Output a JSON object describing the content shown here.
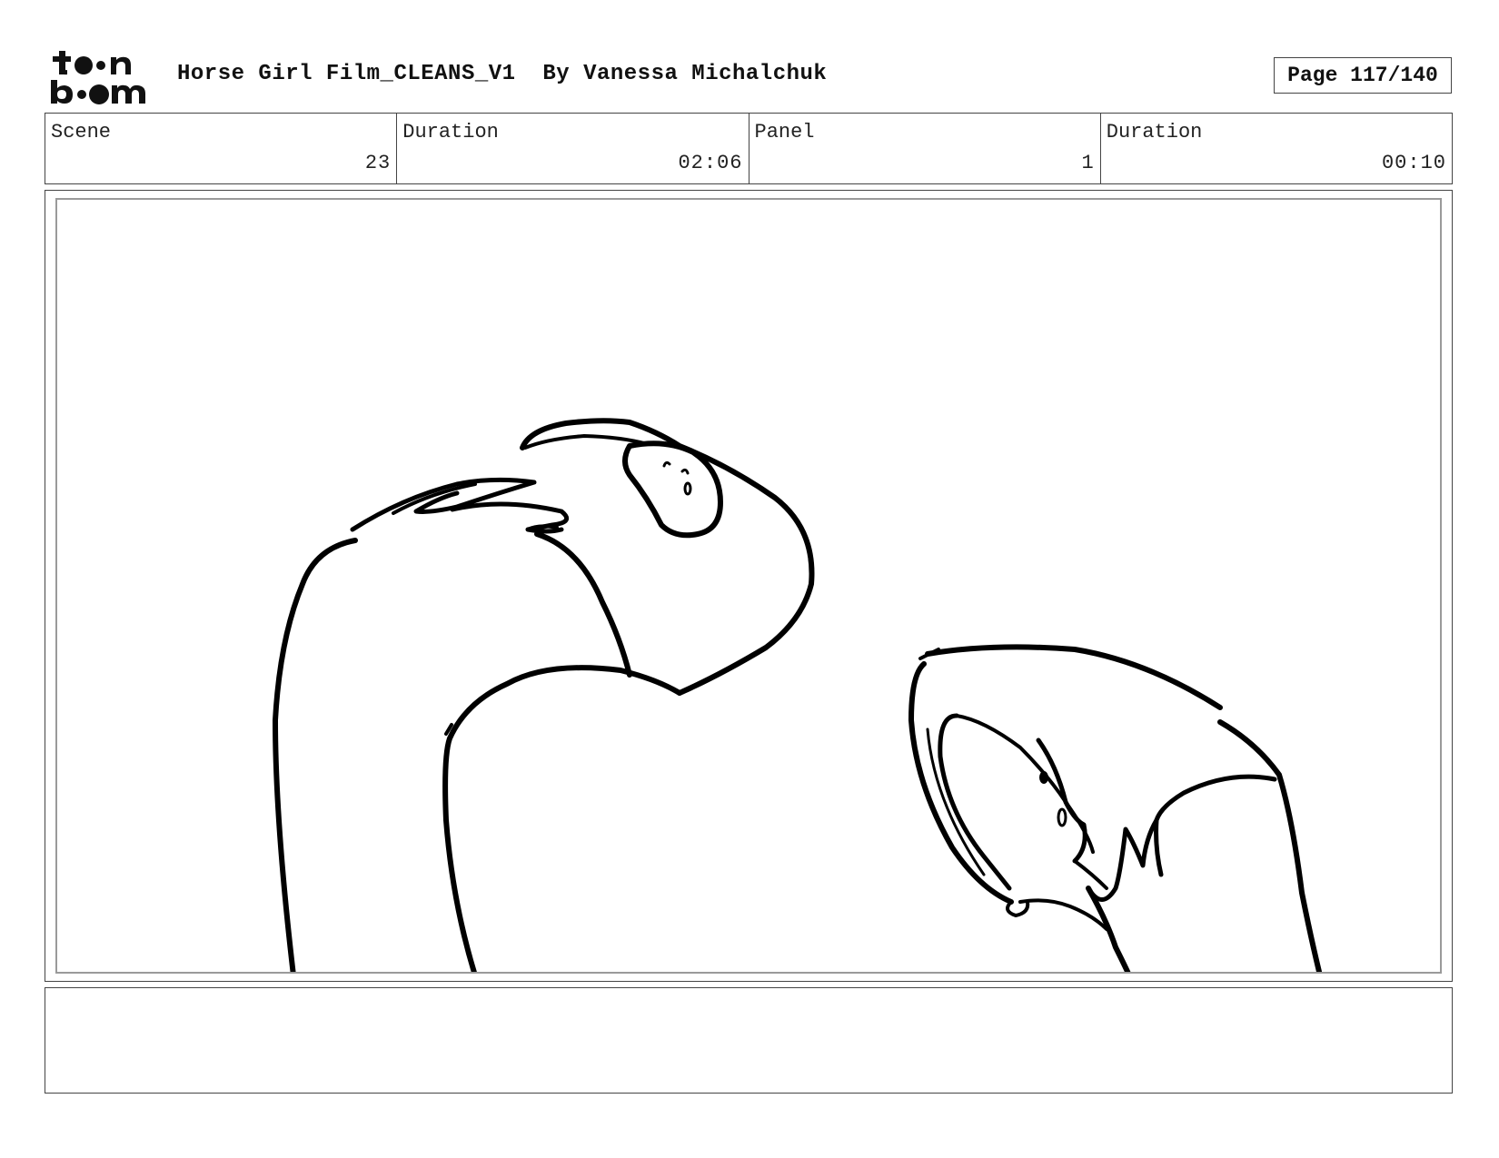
{
  "header": {
    "logo_text": "toon boom",
    "title": "Horse Girl Film_CLEANS_V1  By Vanessa Michalchuk",
    "page": "Page 117/140"
  },
  "info": {
    "scene_label": "Scene",
    "scene_value": "23",
    "scene_duration_label": "Duration",
    "scene_duration_value": "02:06",
    "panel_label": "Panel",
    "panel_value": "1",
    "panel_duration_label": "Duration",
    "panel_duration_value": "00:10"
  },
  "panel": {
    "drawing": "line-art sketch"
  },
  "notes": {
    "text": ""
  }
}
